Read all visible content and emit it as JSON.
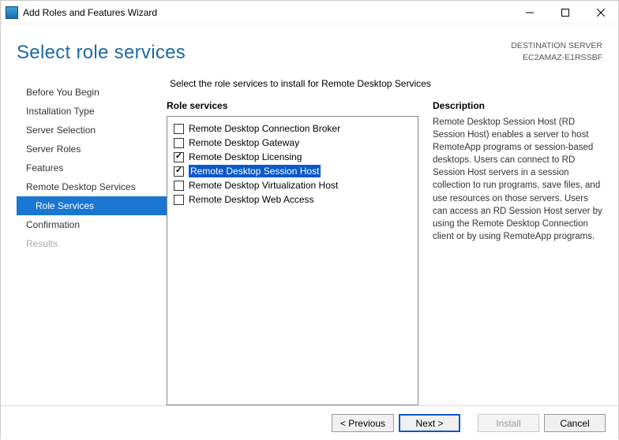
{
  "window": {
    "title": "Add Roles and Features Wizard"
  },
  "header": {
    "title": "Select role services",
    "destination_label": "DESTINATION SERVER",
    "destination_value": "EC2AMAZ-E1RSSBF"
  },
  "nav": {
    "items": [
      {
        "label": "Before You Begin",
        "selected": false,
        "disabled": false,
        "sub": false
      },
      {
        "label": "Installation Type",
        "selected": false,
        "disabled": false,
        "sub": false
      },
      {
        "label": "Server Selection",
        "selected": false,
        "disabled": false,
        "sub": false
      },
      {
        "label": "Server Roles",
        "selected": false,
        "disabled": false,
        "sub": false
      },
      {
        "label": "Features",
        "selected": false,
        "disabled": false,
        "sub": false
      },
      {
        "label": "Remote Desktop Services",
        "selected": false,
        "disabled": false,
        "sub": false
      },
      {
        "label": "Role Services",
        "selected": true,
        "disabled": false,
        "sub": true
      },
      {
        "label": "Confirmation",
        "selected": false,
        "disabled": false,
        "sub": false
      },
      {
        "label": "Results",
        "selected": false,
        "disabled": true,
        "sub": false
      }
    ]
  },
  "main": {
    "intro": "Select the role services to install for Remote Desktop Services",
    "role_services_label": "Role services",
    "description_label": "Description",
    "description_text": "Remote Desktop Session Host (RD Session Host) enables a server to host RemoteApp programs or session-based desktops. Users can connect to RD Session Host servers in a session collection to run programs, save files, and use resources on those servers. Users can access an RD Session Host server by using the Remote Desktop Connection client or by using RemoteApp programs.",
    "services": [
      {
        "label": "Remote Desktop Connection Broker",
        "checked": false,
        "highlighted": false
      },
      {
        "label": "Remote Desktop Gateway",
        "checked": false,
        "highlighted": false
      },
      {
        "label": "Remote Desktop Licensing",
        "checked": true,
        "highlighted": false
      },
      {
        "label": "Remote Desktop Session Host",
        "checked": true,
        "highlighted": true
      },
      {
        "label": "Remote Desktop Virtualization Host",
        "checked": false,
        "highlighted": false
      },
      {
        "label": "Remote Desktop Web Access",
        "checked": false,
        "highlighted": false
      }
    ]
  },
  "footer": {
    "previous": "< Previous",
    "next": "Next >",
    "install": "Install",
    "cancel": "Cancel"
  }
}
